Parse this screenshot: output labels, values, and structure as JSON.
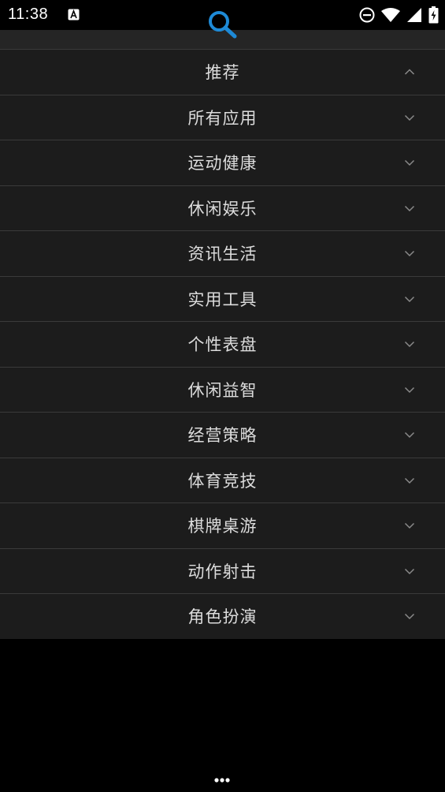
{
  "status_bar": {
    "time": "11:38",
    "icons": [
      "a11y-notification-icon",
      "do-not-disturb-icon",
      "wifi-icon",
      "cell-signal-icon",
      "battery-charging-icon"
    ]
  },
  "toolbar": {
    "search_icon": "search-icon",
    "accent_color": "#1e8ad6"
  },
  "categories": [
    {
      "label": "推荐",
      "expanded": true
    },
    {
      "label": "所有应用",
      "expanded": false
    },
    {
      "label": "运动健康",
      "expanded": false
    },
    {
      "label": "休闲娱乐",
      "expanded": false
    },
    {
      "label": "资讯生活",
      "expanded": false
    },
    {
      "label": "实用工具",
      "expanded": false
    },
    {
      "label": "个性表盘",
      "expanded": false
    },
    {
      "label": "休闲益智",
      "expanded": false
    },
    {
      "label": "经营策略",
      "expanded": false
    },
    {
      "label": "体育竞技",
      "expanded": false
    },
    {
      "label": "棋牌桌游",
      "expanded": false
    },
    {
      "label": "动作射击",
      "expanded": false
    },
    {
      "label": "角色扮演",
      "expanded": false
    }
  ],
  "footer": {
    "more_icon": "more-dots-icon"
  }
}
